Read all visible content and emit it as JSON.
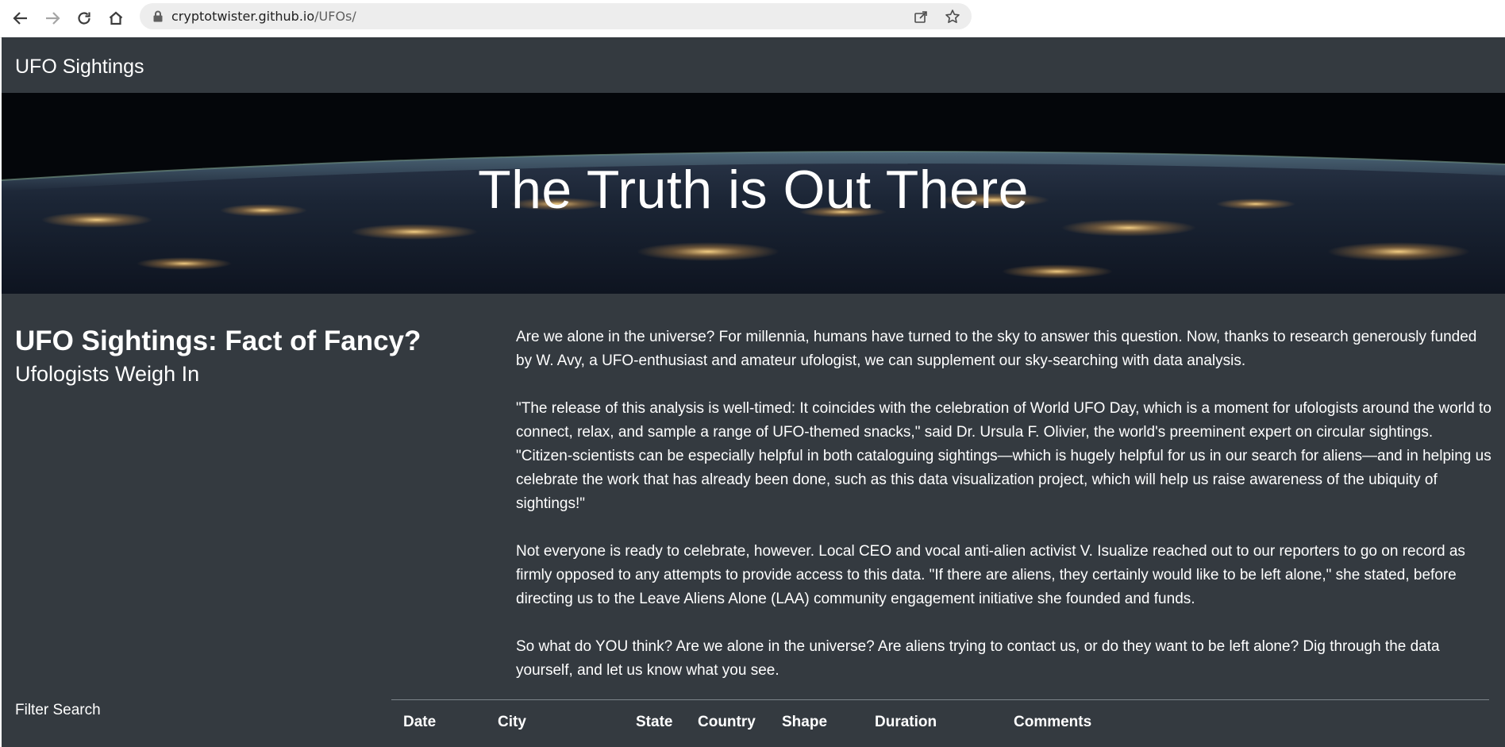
{
  "browser": {
    "url_domain": "cryptotwister.github.io",
    "url_path": "/UFOs/",
    "icons": [
      "back-icon",
      "forward-icon",
      "reload-icon",
      "home-icon",
      "lock-icon",
      "share-icon",
      "star-icon"
    ]
  },
  "navbar": {
    "brand": "UFO Sightings"
  },
  "hero": {
    "title": "The Truth is Out There"
  },
  "intro": {
    "heading": "UFO Sightings: Fact of Fancy?",
    "subheading": "Ufologists Weigh In"
  },
  "article": {
    "paragraphs": [
      "Are we alone in the universe? For millennia, humans have turned to the sky to answer this question. Now, thanks to research generously funded by W. Avy, a UFO-enthusiast and amateur ufologist, we can supplement our sky-searching with data analysis.",
      "\"The release of this analysis is well-timed: It coincides with the celebration of World UFO Day, which is a moment for ufologists around the world to connect, relax, and sample a range of UFO-themed snacks,\" said Dr. Ursula F. Olivier, the world's preeminent expert on circular sightings. \"Citizen-scientists can be especially helpful in both cataloguing sightings—which is hugely helpful for us in our search for aliens—and in helping us celebrate the work that has already been done, such as this data visualization project, which will help us raise awareness of the ubiquity of sightings!\"",
      "Not everyone is ready to celebrate, however. Local CEO and vocal anti-alien activist V. Isualize reached out to our reporters to go on record as firmly opposed to any attempts to provide access to this data. \"If there are aliens, they certainly would like to be left alone,\" she stated, before directing us to the Leave Aliens Alone (LAA) community engagement initiative she founded and funds.",
      "So what do YOU think? Are we alone in the universe? Are aliens trying to contact us, or do they want to be left alone? Dig through the data yourself, and let us know what you see."
    ]
  },
  "filter": {
    "label": "Filter Search"
  },
  "table": {
    "columns": [
      "Date",
      "City",
      "State",
      "Country",
      "Shape",
      "Duration",
      "Comments"
    ]
  }
}
